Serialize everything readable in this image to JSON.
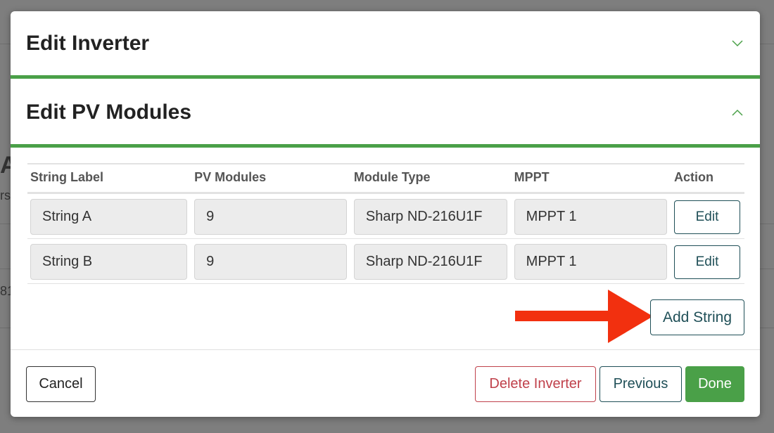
{
  "background": {
    "fragments": [
      "A",
      "rs",
      "81"
    ]
  },
  "modal": {
    "sections": [
      {
        "title": "Edit Inverter",
        "state": "collapsed",
        "icon": "chevron-down-icon"
      },
      {
        "title": "Edit PV Modules",
        "state": "expanded",
        "icon": "chevron-up-icon"
      }
    ],
    "table": {
      "headers": [
        "String Label",
        "PV Modules",
        "Module Type",
        "MPPT",
        "Action"
      ],
      "rows": [
        {
          "label": "String A",
          "modules": "9",
          "module_type": "Sharp ND-216U1F",
          "mppt": "MPPT 1",
          "action": "Edit"
        },
        {
          "label": "String B",
          "modules": "9",
          "module_type": "Sharp ND-216U1F",
          "mppt": "MPPT 1",
          "action": "Edit"
        }
      ]
    },
    "add_string_label": "Add String",
    "annotation": {
      "type": "red-arrow-icon",
      "color": "#f2300f"
    },
    "footer": {
      "cancel_label": "Cancel",
      "delete_label": "Delete Inverter",
      "previous_label": "Previous",
      "done_label": "Done"
    }
  },
  "colors": {
    "accent_green": "#4aa048",
    "teal": "#1f4f57",
    "danger": "#c0414b"
  }
}
